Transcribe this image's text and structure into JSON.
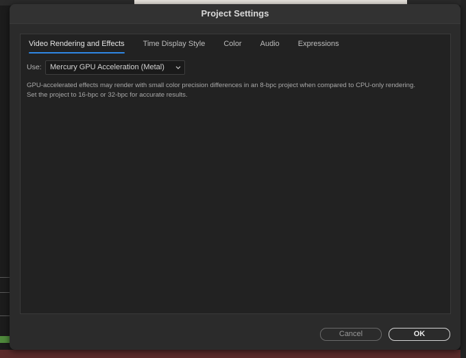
{
  "dialog": {
    "title": "Project Settings"
  },
  "tabs": [
    {
      "label": "Video Rendering and Effects",
      "active": true
    },
    {
      "label": "Time Display Style",
      "active": false
    },
    {
      "label": "Color",
      "active": false
    },
    {
      "label": "Audio",
      "active": false
    },
    {
      "label": "Expressions",
      "active": false
    }
  ],
  "use": {
    "label": "Use:",
    "selected": "Mercury GPU Acceleration (Metal)",
    "icon": "chevron-down-icon"
  },
  "description": {
    "line1": "GPU-accelerated effects may render with small color precision differences in an 8-bpc project when compared to CPU-only rendering.",
    "line2": "Set the project to 16-bpc or 32-bpc for accurate results."
  },
  "buttons": {
    "cancel": "Cancel",
    "ok": "OK"
  },
  "colors": {
    "accent": "#2f88e6",
    "dialog_bg": "#2b2b2b",
    "panel_bg": "#222222"
  }
}
